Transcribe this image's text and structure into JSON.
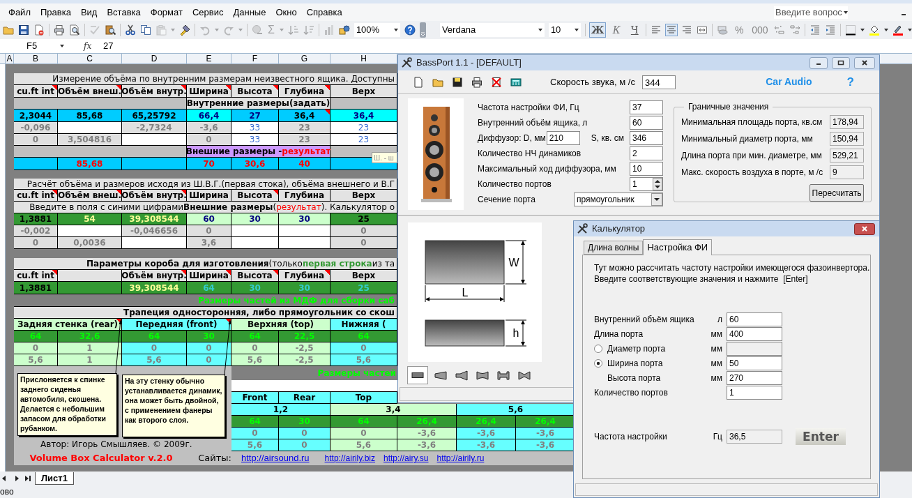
{
  "excel": {
    "menu": [
      "Файл",
      "Правка",
      "Вид",
      "Вставка",
      "Формат",
      "Сервис",
      "Данные",
      "Окно",
      "Справка"
    ],
    "help_box": {
      "placeholder": "Введите вопрос"
    },
    "standard_toolbar": [
      {
        "kind": "open",
        "disabled": false
      },
      {
        "kind": "save",
        "disabled": false
      },
      {
        "kind": "permission",
        "disabled": false
      },
      {
        "kind": "print",
        "disabled": false
      },
      {
        "kind": "preview",
        "disabled": false
      },
      {
        "kind": "spelling",
        "disabled": true
      },
      {
        "kind": "research",
        "disabled": false
      },
      {
        "kind": "cut",
        "disabled": false
      },
      {
        "kind": "copy",
        "disabled": false
      },
      {
        "kind": "paste",
        "disabled": true
      },
      {
        "kind": "painter",
        "disabled": false
      },
      {
        "kind": "undo",
        "disabled": true
      },
      {
        "kind": "redo",
        "disabled": true
      },
      {
        "kind": "hyperlink",
        "disabled": true
      },
      {
        "kind": "autosum",
        "label": "Σ",
        "disabled": true
      },
      {
        "kind": "sort_asc",
        "disabled": true
      },
      {
        "kind": "sort_desc",
        "disabled": true
      },
      {
        "kind": "chart",
        "disabled": true
      },
      {
        "kind": "drawing",
        "disabled": false
      },
      {
        "kind": "zoom",
        "label": "100%",
        "disabled": false
      },
      {
        "kind": "help",
        "disabled": false
      },
      {
        "kind": "options",
        "disabled": false
      }
    ],
    "formatting_toolbar": [
      {
        "kind": "font",
        "label": "Verdana",
        "pressed": false
      },
      {
        "kind": "size",
        "label": "10",
        "pressed": false
      },
      {
        "kind": "bold",
        "label": "Ж",
        "pressed": true
      },
      {
        "kind": "italic",
        "label": "К",
        "pressed": false
      },
      {
        "kind": "underline",
        "label": "Ч",
        "pressed": false
      },
      {
        "kind": "align_left",
        "pressed": false
      },
      {
        "kind": "align_center",
        "pressed": true
      },
      {
        "kind": "align_right",
        "pressed": false
      },
      {
        "kind": "merge",
        "pressed": false
      },
      {
        "kind": "currency",
        "pressed": false
      },
      {
        "kind": "percent",
        "label": "%",
        "pressed": false
      },
      {
        "kind": "thousands",
        "label": "000",
        "pressed": false
      },
      {
        "kind": "inc_decimal",
        "pressed": false
      },
      {
        "kind": "dec_decimal",
        "pressed": false
      },
      {
        "kind": "outdent",
        "pressed": false
      },
      {
        "kind": "indent",
        "pressed": false
      },
      {
        "kind": "borders",
        "pressed": false
      },
      {
        "kind": "fill",
        "pressed": false
      },
      {
        "kind": "font_color",
        "pressed": false
      }
    ],
    "name_box": "F5",
    "fx_label": "fx",
    "formula": "27",
    "columns": [
      "A",
      "B",
      "C",
      "D",
      "E",
      "F",
      "G",
      "H"
    ],
    "sheet_rows": [
      {
        "cells": [
          {
            "text": "Измерение объёма по внутренним размерам неизвестного ящика. Доступны",
            "kind": "title"
          }
        ]
      },
      {
        "cells": [
          {
            "text": "cu.ft int",
            "kind": "head",
            "note": true
          },
          {
            "text": "Объём внеш.",
            "kind": "head",
            "note": true
          },
          {
            "text": "Объём внутр.",
            "kind": "head",
            "note": true
          },
          {
            "text": "Ширина",
            "kind": "head",
            "note": true
          },
          {
            "text": "Высота",
            "kind": "head",
            "note": true
          },
          {
            "text": "Глубина",
            "kind": "head",
            "note": true
          },
          {
            "text": "Верх",
            "kind": "head"
          }
        ]
      },
      {
        "cells": [
          {
            "kind": "gray"
          },
          {
            "text": "Внутренние размеры(задать)",
            "kind": "head"
          },
          {
            "kind": "gray"
          }
        ]
      },
      {
        "cells": [
          {
            "text": "2,3044",
            "kind": "skyb"
          },
          {
            "text": "85,68",
            "kind": "skyb"
          },
          {
            "text": "65,25792",
            "kind": "skyb"
          },
          {
            "text": "66,4",
            "kind": "cyann"
          },
          {
            "text": "27",
            "kind": "skyn"
          },
          {
            "text": "36,4",
            "kind": "skyb",
            "note": true
          },
          {
            "text": "36,4",
            "kind": "cyann"
          }
        ]
      },
      {
        "cells": [
          {
            "text": "-0,096",
            "kind": "dis"
          },
          {
            "kind": "white"
          },
          {
            "text": "-2,7324",
            "kind": "dis"
          },
          {
            "text": "-3,6",
            "kind": "dis"
          },
          {
            "text": "33",
            "kind": "whiteblue"
          },
          {
            "text": "23",
            "kind": "dis"
          },
          {
            "text": "23",
            "kind": "whiteblue"
          }
        ]
      },
      {
        "cells": [
          {
            "text": "0",
            "kind": "dis"
          },
          {
            "text": "3,504816",
            "kind": "dis"
          },
          {
            "kind": "white"
          },
          {
            "text": "0",
            "kind": "dis"
          },
          {
            "text": "33",
            "kind": "whiteblue"
          },
          {
            "text": "23",
            "kind": "dis"
          },
          {
            "text": "23",
            "kind": "whiteblue"
          }
        ]
      },
      {
        "cells": [
          {
            "kind": "gray"
          },
          {
            "kind": "purple",
            "parts": [
              {
                "text": "Внешние размеры - ",
                "kind": "plain"
              },
              {
                "text": "результат",
                "kind": "red"
              }
            ]
          },
          {
            "kind": "gray"
          }
        ]
      },
      {
        "cells": [
          {
            "kind": "sky"
          },
          {
            "text": "85,68",
            "kind": "skyred"
          },
          {
            "kind": "sky"
          },
          {
            "text": "70",
            "kind": "skyred"
          },
          {
            "text": "30,6",
            "kind": "skyred"
          },
          {
            "text": "40",
            "kind": "skyred"
          },
          {
            "kind": "sky"
          }
        ]
      },
      {
        "cells": [
          {
            "text": "Расчёт объёма и размеров исходя из Ш.В.Г.(первая стока), объёма внешнего и В.Г",
            "kind": "title"
          }
        ]
      },
      {
        "cells": [
          {
            "text": "cu.ft int",
            "kind": "head",
            "note": true
          },
          {
            "text": "Объём внеш.",
            "kind": "head",
            "note": true
          },
          {
            "text": "Объём внутр.",
            "kind": "head",
            "note": true
          },
          {
            "text": "Ширина",
            "kind": "head"
          },
          {
            "text": "Высота",
            "kind": "head",
            "note": true
          },
          {
            "text": "Глубина",
            "kind": "head"
          },
          {
            "text": "Верх",
            "kind": "head"
          }
        ]
      },
      {
        "cells": [
          {
            "kind": "title",
            "parts": [
              {
                "text": "Введите в поля с синими цифрами ",
                "kind": "plain"
              },
              {
                "text": "Внешние размеры",
                "kind": "bold"
              },
              {
                "text": "(",
                "kind": "plain"
              },
              {
                "text": "результат",
                "kind": "red"
              },
              {
                "text": "). Калькулятор о",
                "kind": "plain"
              }
            ]
          }
        ]
      },
      {
        "cells": [
          {
            "text": "1,3881",
            "kind": "green"
          },
          {
            "text": "54",
            "kind": "greenyel"
          },
          {
            "text": "39,308544",
            "kind": "greenyel"
          },
          {
            "text": "60",
            "kind": "lgnavy"
          },
          {
            "text": "30",
            "kind": "lgnavy"
          },
          {
            "text": "30",
            "kind": "lgnavy"
          },
          {
            "text": "25",
            "kind": "green"
          }
        ]
      },
      {
        "cells": [
          {
            "text": "-0,002",
            "kind": "dis"
          },
          {
            "kind": "white"
          },
          {
            "text": "-0,046656",
            "kind": "dis"
          },
          {
            "text": "0",
            "kind": "dis"
          },
          {
            "kind": "white"
          },
          {
            "kind": "white"
          },
          {
            "text": "0",
            "kind": "dis"
          }
        ]
      },
      {
        "cells": [
          {
            "text": "0",
            "kind": "dis"
          },
          {
            "text": "0,0036",
            "kind": "dis"
          },
          {
            "kind": "white"
          },
          {
            "text": "3,6",
            "kind": "dis"
          },
          {
            "kind": "white"
          },
          {
            "kind": "white"
          },
          {
            "text": "0",
            "kind": "dis"
          }
        ]
      },
      {
        "cells": [
          {
            "kind": "title",
            "parts": [
              {
                "text": "Параметры короба для изготовления",
                "kind": "bold"
              },
              {
                "text": "(только ",
                "kind": "plain"
              },
              {
                "text": "первая строка",
                "kind": "boldgreen"
              },
              {
                "text": " из та",
                "kind": "plain"
              }
            ]
          }
        ]
      },
      {
        "cells": [
          {
            "text": "cu.ft int",
            "kind": "head",
            "note": true
          },
          {
            "kind": "head"
          },
          {
            "text": "Объём внутр.",
            "kind": "head",
            "note": true
          },
          {
            "text": "Ширина",
            "kind": "head",
            "note": true
          },
          {
            "text": "Высота",
            "kind": "head",
            "note": true
          },
          {
            "text": "Глубина",
            "kind": "head",
            "note": true
          },
          {
            "text": "Верх",
            "kind": "head"
          }
        ]
      },
      {
        "cells": [
          {
            "text": "1,3881",
            "kind": "green"
          },
          {
            "kind": "green"
          },
          {
            "text": "39,308544",
            "kind": "greenyel"
          },
          {
            "text": "64",
            "kind": "greency"
          },
          {
            "text": "30",
            "kind": "greency"
          },
          {
            "text": "30",
            "kind": "greency"
          },
          {
            "text": "25",
            "kind": "greency"
          }
        ]
      },
      {
        "cells": [
          {
            "text": "Размеры частей из МДФ для сборки саб",
            "kind": "bandgreen"
          }
        ]
      },
      {
        "cells": [
          {
            "text": "Трапеция односторонняя, либо прямоугольник со скош",
            "kind": "titleb"
          }
        ]
      },
      {
        "cells": [
          {
            "text": "Задняя стенка (rear)",
            "kind": "lg",
            "note": true
          },
          {
            "text": "Передняя (front)",
            "kind": "cy",
            "note": true
          },
          {
            "text": "Верхняя (top)",
            "kind": "lg"
          },
          {
            "text": "Нижняя (",
            "kind": "cy"
          }
        ]
      },
      {
        "cells": [
          {
            "text": "64",
            "kind": "greenlime"
          },
          {
            "text": "32,6",
            "kind": "greenlime"
          },
          {
            "text": "64",
            "kind": "greenlime"
          },
          {
            "text": "30",
            "kind": "greenlime"
          },
          {
            "text": "64",
            "kind": "greenlime"
          },
          {
            "text": "22,5",
            "kind": "greenlime"
          },
          {
            "text": "64",
            "kind": "greenlime"
          }
        ]
      },
      {
        "cells": [
          {
            "text": "0",
            "kind": "lgdis"
          },
          {
            "text": "1",
            "kind": "lgdis"
          },
          {
            "text": "0",
            "kind": "cydis"
          },
          {
            "text": "0",
            "kind": "cydis"
          },
          {
            "text": "0",
            "kind": "lgdis"
          },
          {
            "text": "-2,5",
            "kind": "lgdis"
          },
          {
            "text": "0",
            "kind": "cydis"
          }
        ]
      },
      {
        "cells": [
          {
            "text": "5,6",
            "kind": "lgdis"
          },
          {
            "text": "1",
            "kind": "lgdis"
          },
          {
            "text": "5,6",
            "kind": "cydis"
          },
          {
            "text": "0",
            "kind": "cydis"
          },
          {
            "text": "5,6",
            "kind": "lgdis"
          },
          {
            "text": "-2,5",
            "kind": "lgdis"
          },
          {
            "text": "5,6",
            "kind": "cydis"
          }
        ]
      }
    ],
    "tooltip": "Ш. - ш",
    "parts_heading": "Размеры частей",
    "lower_rows": [
      {
        "cells": [
          {
            "text": "Front",
            "kind": "cy"
          },
          {
            "text": "Rear",
            "kind": "cy"
          },
          {
            "text": "Top",
            "kind": "cy"
          }
        ]
      },
      {
        "cells": [
          {
            "text": "1,2",
            "kind": "cy"
          },
          {
            "text": "3,4",
            "kind": "lg"
          },
          {
            "text": "5,6",
            "kind": "cy"
          }
        ]
      },
      {
        "cells": [
          {
            "text": "64",
            "kind": "greenlime"
          },
          {
            "text": "30",
            "kind": "greenlime"
          },
          {
            "text": "64",
            "kind": "greenlime"
          },
          {
            "text": "26,4",
            "kind": "greenlime"
          },
          {
            "text": "26,4",
            "kind": "greenlime"
          },
          {
            "text": "26,4",
            "kind": "greenlime"
          }
        ]
      },
      {
        "cells": [
          {
            "text": "0",
            "kind": "cydis"
          },
          {
            "text": "0",
            "kind": "cydis"
          },
          {
            "text": "0",
            "kind": "lgdis"
          },
          {
            "text": "-3,6",
            "kind": "lgdis"
          },
          {
            "text": "-3,6",
            "kind": "cydis"
          },
          {
            "text": "-3,6",
            "kind": "cydis"
          }
        ]
      },
      {
        "cells": [
          {
            "text": "5,6",
            "kind": "cydis"
          },
          {
            "text": "0",
            "kind": "cydis"
          },
          {
            "text": "5,6",
            "kind": "lgdis"
          },
          {
            "text": "-3,6",
            "kind": "lgdis"
          },
          {
            "text": "-3,6",
            "kind": "cydis"
          },
          {
            "text": "-3,6",
            "kind": "cydis"
          }
        ]
      }
    ],
    "notes": [
      "Прислоняется к спинке заднего сиденья автомобиля, скошена. Делается с небольшим запасом для обработки рубанком.",
      "На эту стенку обычно устанавливается динамик, она может быть двойной, с применением фанеры как второго слоя."
    ],
    "author": "Автор: Игорь Смышляев. © 2009г.",
    "product": "Volume Box Calculator v.2.0",
    "sites_label": "Сайты:",
    "links": [
      "http://airsound.ru",
      "http://airily.biz",
      "http://airy.su",
      "http://airily.ru"
    ],
    "sheet_tabs": [
      {
        "label": "Лист1",
        "selected": true
      }
    ],
    "status": "ово"
  },
  "bassport": {
    "title": "BassPort 1.1 - [DEFAULT]",
    "toolbar": [
      {
        "kind": "new"
      },
      {
        "kind": "open"
      },
      {
        "kind": "save"
      },
      {
        "kind": "print"
      },
      {
        "kind": "delete"
      },
      {
        "kind": "calculator"
      }
    ],
    "sound_speed": {
      "label": "Скорость звука, м /с",
      "value": "344"
    },
    "brand_link": "Car Audio",
    "help": "?",
    "fields": [
      {
        "kind": "text",
        "label": "Частота настройки ФИ, Гц",
        "value": "37"
      },
      {
        "kind": "text",
        "label": "Внутренний объём ящика, л",
        "value": "60"
      },
      {
        "kind": "pair",
        "label": "Диффузор: D, мм",
        "value": "210",
        "label2": "S, кв. см",
        "value2": "346"
      },
      {
        "kind": "text",
        "label": "Количество НЧ динамиков",
        "value": "2"
      },
      {
        "kind": "text",
        "label": "Максимальный ход диффузора, мм",
        "value": "10"
      },
      {
        "kind": "spin",
        "label": "Количество портов",
        "value": "1"
      },
      {
        "kind": "combo",
        "label": "Сечение порта",
        "value": "прямоугольник"
      }
    ],
    "limits": {
      "title": "Граничные значения",
      "rows": [
        {
          "label": "Минимальная площадь порта, кв.см",
          "value": "178,94"
        },
        {
          "label": "Минимальный диаметр порта, мм",
          "value": "150,94"
        },
        {
          "label": "Длина порта при мин. диаметре, мм",
          "value": "529,21"
        },
        {
          "label": "Макс. скорость воздуха в порте, м /с",
          "value": "9"
        }
      ],
      "button": "Пересчитать"
    },
    "diagram_labels": [
      "W",
      "L",
      "h"
    ],
    "shapes": [
      {
        "kind": "box",
        "selected": true
      },
      {
        "kind": "cone",
        "selected": false
      },
      {
        "kind": "horn",
        "selected": false
      },
      {
        "kind": "double_flare",
        "selected": false
      },
      {
        "kind": "flanged",
        "selected": false
      },
      {
        "kind": "bowtie",
        "selected": false
      }
    ]
  },
  "calculator": {
    "title": "Калькулятор",
    "tabs": [
      {
        "label": "Длина волны",
        "selected": false
      },
      {
        "label": "Настройка ФИ",
        "selected": true
      }
    ],
    "intro": [
      "Тут можно рассчитать частоту настройки имеющегося фазоинвертора.",
      "Введите соответствующие значения и нажмите  [Enter]"
    ],
    "fields": [
      {
        "kind": "text",
        "label": "Внутренний объём ящика",
        "unit": "л",
        "value": "60",
        "disabled": false
      },
      {
        "kind": "text",
        "label": "Длина порта",
        "unit": "мм",
        "value": "400",
        "disabled": false
      },
      {
        "kind": "radio",
        "label": "Диаметр порта",
        "unit": "мм",
        "checked": false,
        "disabled": true
      },
      {
        "kind": "radio",
        "label": "Ширина порта",
        "unit": "мм",
        "value": "50",
        "checked": true,
        "disabled": false
      },
      {
        "kind": "indent",
        "label": "Высота порта",
        "unit": "мм",
        "value": "270",
        "disabled": false
      },
      {
        "kind": "text",
        "label": "Количество портов",
        "value": "1",
        "disabled": false
      }
    ],
    "result": {
      "label": "Частота настройки",
      "unit": "Гц",
      "value": "36,5"
    },
    "button": "Enter"
  }
}
